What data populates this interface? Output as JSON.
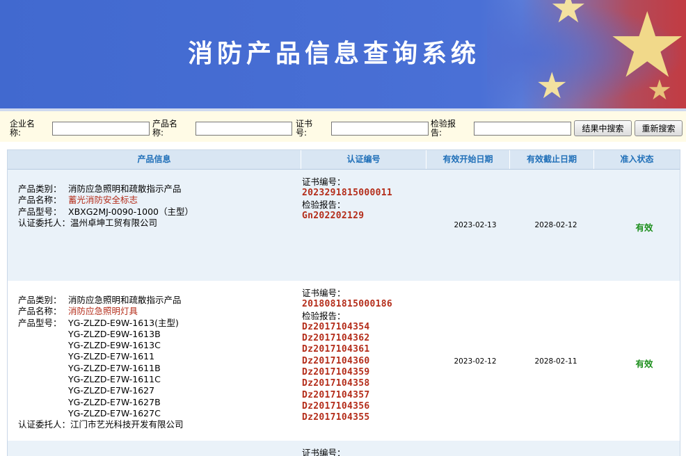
{
  "header": {
    "title": "消防产品信息查询系统"
  },
  "search": {
    "company_label": "企业名称:",
    "product_label": "产品名称:",
    "cert_label": "证书号:",
    "report_label": "检验报告:",
    "company_value": "",
    "product_value": "",
    "cert_value": "",
    "report_value": "",
    "search_in_results": "结果中搜索",
    "new_search": "重新搜索"
  },
  "table": {
    "headers": [
      "产品信息",
      "认证编号",
      "有效开始日期",
      "有效截止日期",
      "准入状态"
    ],
    "labels": {
      "category": "产品类别：",
      "name": "产品名称：",
      "model": "产品型号：",
      "client": "认证委托人：",
      "cert_no": "证书编号：",
      "report": "检验报告："
    },
    "rows": [
      {
        "category": "消防应急照明和疏散指示产品",
        "name": "蓄光消防安全标志",
        "models": [
          "XBXG2MJ-0090-1000（主型）"
        ],
        "client": "温州卓坤工贸有限公司",
        "cert_no": "2023291815000011",
        "reports": [
          "Gn202202129"
        ],
        "start": "2023-02-13",
        "end": "2028-02-12",
        "status": "有效"
      },
      {
        "category": "消防应急照明和疏散指示产品",
        "name": "消防应急照明灯具",
        "models": [
          "YG-ZLZD-E9W-1613(主型)",
          "YG-ZLZD-E9W-1613B",
          "YG-ZLZD-E9W-1613C",
          "YG-ZLZD-E7W-1611",
          "YG-ZLZD-E7W-1611B",
          "YG-ZLZD-E7W-1611C",
          "YG-ZLZD-E7W-1627",
          "YG-ZLZD-E7W-1627B",
          "YG-ZLZD-E7W-1627C"
        ],
        "client": "江门市艺光科技开发有限公司",
        "cert_no": "2018081815000186",
        "reports": [
          "Dz2017104354",
          "Dz2017104362",
          "Dz2017104361",
          "Dz2017104360",
          "Dz2017104359",
          "Dz2017104358",
          "Dz2017104357",
          "Dz2017104356",
          "Dz2017104355"
        ],
        "start": "2023-02-12",
        "end": "2028-02-11",
        "status": "有效"
      },
      {
        "cert_label_partial": "证书编号："
      }
    ]
  },
  "colors": {
    "banner_blue": "#4169cf",
    "header_text": "#1f6fb8",
    "red_value": "#b42d1a",
    "valid_green": "#1d8f1d",
    "row_alt": "#eaf2f9"
  }
}
